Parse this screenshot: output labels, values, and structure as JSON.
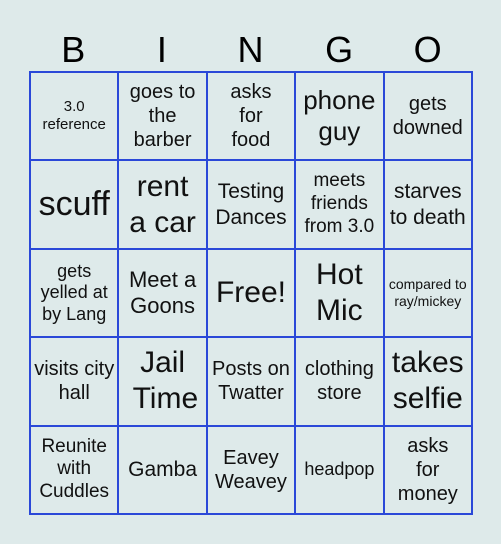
{
  "header": [
    "B",
    "I",
    "N",
    "G",
    "O"
  ],
  "cells": [
    [
      "3.0 reference",
      "goes to the barber",
      "asks for food",
      "phone guy",
      "gets downed"
    ],
    [
      "scuff",
      "rent a car",
      "Testing Dances",
      "meets friends from 3.0",
      "starves to death"
    ],
    [
      "gets yelled at by Lang",
      "Meet a Goons",
      "Free!",
      "Hot Mic",
      "compared to ray/mickey"
    ],
    [
      "visits city hall",
      "Jail Time",
      "Posts on Twatter",
      "clothing store",
      "takes selfie"
    ],
    [
      "Reunite with Cuddles",
      "Gamba",
      "Eavey Weavey",
      "headpop",
      "asks for money"
    ]
  ],
  "colors": {
    "background": "#deeaea",
    "grid": "#2a48d8"
  }
}
